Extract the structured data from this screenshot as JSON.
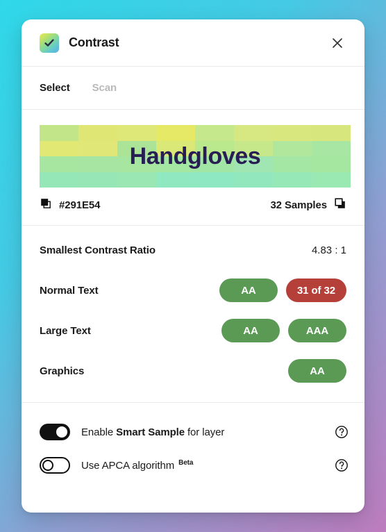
{
  "background": {
    "gradient_from": "#2fd8e8",
    "gradient_to": "#bd7cbe"
  },
  "header": {
    "title": "Contrast",
    "icon": "contrast-check-icon",
    "close_icon": "close-icon"
  },
  "tabs": [
    {
      "label": "Select",
      "active": true
    },
    {
      "label": "Scan",
      "active": false
    }
  ],
  "preview": {
    "sample_text": "Handgloves",
    "text_color": "#291E54",
    "hex_label": "#291E54",
    "hex_icon": "copy-foreground-icon",
    "samples_label": "32 Samples",
    "samples_icon": "copy-background-icon",
    "swatch_colors": [
      "#c3e589",
      "#dfe674",
      "#dde878",
      "#e5e965",
      "#c6e88d",
      "#d7e882",
      "#d9e77f",
      "#d7e77e",
      "#e2e874",
      "#e0e777",
      "#abe497",
      "#d9e877",
      "#b9e88d",
      "#c6e78a",
      "#b1e79c",
      "#a8e6a3",
      "#a7e6a0",
      "#a6e6a2",
      "#a6e6a1",
      "#a4e7a3",
      "#a2e6a5",
      "#9fe6b2",
      "#a4e6a3",
      "#a5e6a1",
      "#96e7b8",
      "#97e7b6",
      "#9ae7b3",
      "#8fe8c0",
      "#8ee8c2",
      "#92e8bc",
      "#96e8b7",
      "#9ae8b2"
    ]
  },
  "results": {
    "ratio": {
      "label": "Smallest Contrast Ratio",
      "value": "4.83 : 1"
    },
    "rows": [
      {
        "label": "Normal Text",
        "badges": [
          {
            "text": "AA",
            "state": "pass"
          },
          {
            "text": "31 of 32",
            "state": "fail"
          }
        ]
      },
      {
        "label": "Large Text",
        "badges": [
          {
            "text": "AA",
            "state": "pass"
          },
          {
            "text": "AAA",
            "state": "pass"
          }
        ]
      },
      {
        "label": "Graphics",
        "badges": [
          {
            "text": "AA",
            "state": "pass"
          }
        ]
      }
    ],
    "pass_color": "#5a9a55",
    "fail_color": "#b5403a"
  },
  "settings": [
    {
      "state": "on",
      "label_prefix": "Enable ",
      "label_strong": "Smart Sample",
      "label_suffix": " for layer",
      "badge": "",
      "help_icon": "help-circle-icon"
    },
    {
      "state": "off",
      "label_prefix": "Use APCA algorithm",
      "label_strong": "",
      "label_suffix": "",
      "badge": "Beta",
      "help_icon": "help-circle-icon"
    }
  ]
}
